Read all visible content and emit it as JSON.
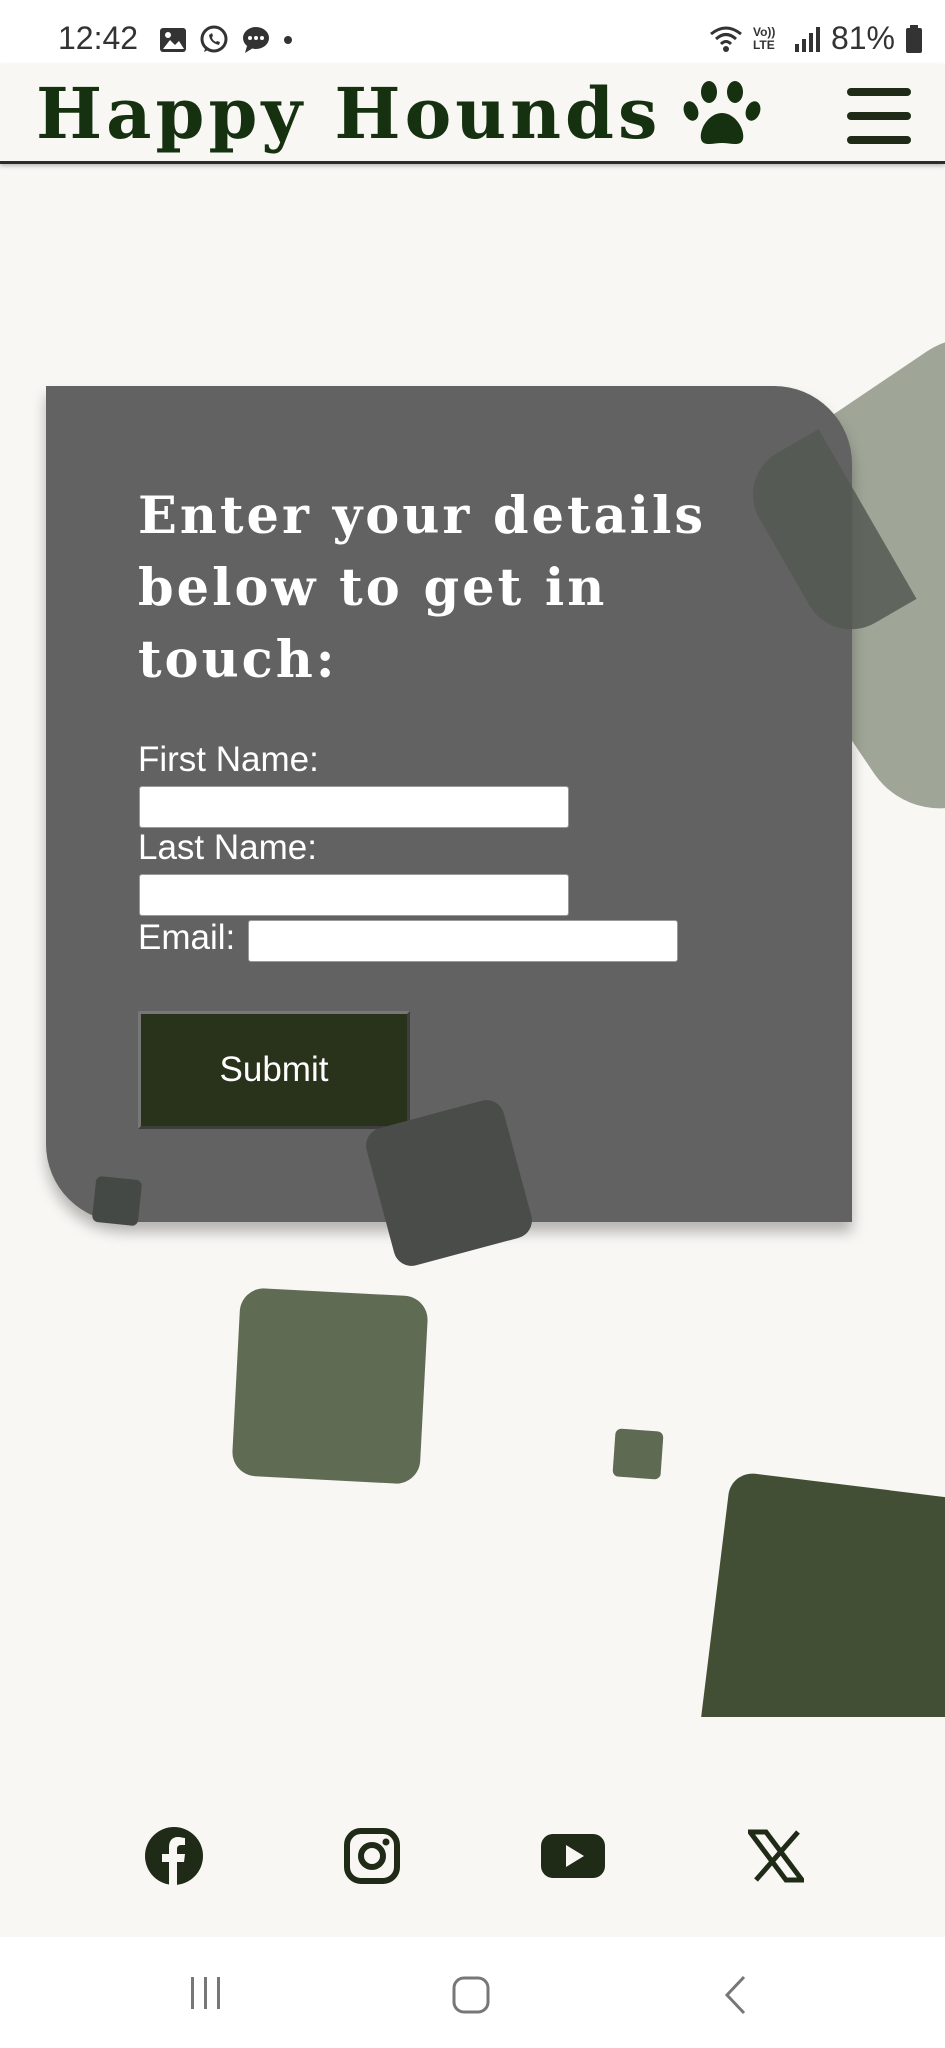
{
  "status_bar": {
    "time": "12:42",
    "battery": "81%",
    "network_label": "Vo)) LTE"
  },
  "header": {
    "title": "Happy Hounds",
    "logo_icon": "paw-icon",
    "menu_icon": "hamburger-menu-icon"
  },
  "form": {
    "heading": "Enter your details below to get in touch:",
    "first_name_label": "First Name:",
    "first_name_value": "",
    "last_name_label": "Last Name:",
    "last_name_value": "",
    "email_label": "Email:",
    "email_value": "",
    "submit_label": "Submit"
  },
  "social": {
    "icons": [
      "facebook-icon",
      "instagram-icon",
      "youtube-icon",
      "x-twitter-icon"
    ]
  },
  "nav_bar": {
    "icons": [
      "recent-apps-icon",
      "home-icon",
      "back-icon"
    ]
  },
  "colors": {
    "background": "#f8f7f4",
    "brand_green": "#15310f",
    "card_gray": "#626262",
    "button_green": "#29331b",
    "shape_green_dark": "#434f35",
    "shape_green_mid": "#606b54",
    "shape_sage": "#9fa697"
  }
}
